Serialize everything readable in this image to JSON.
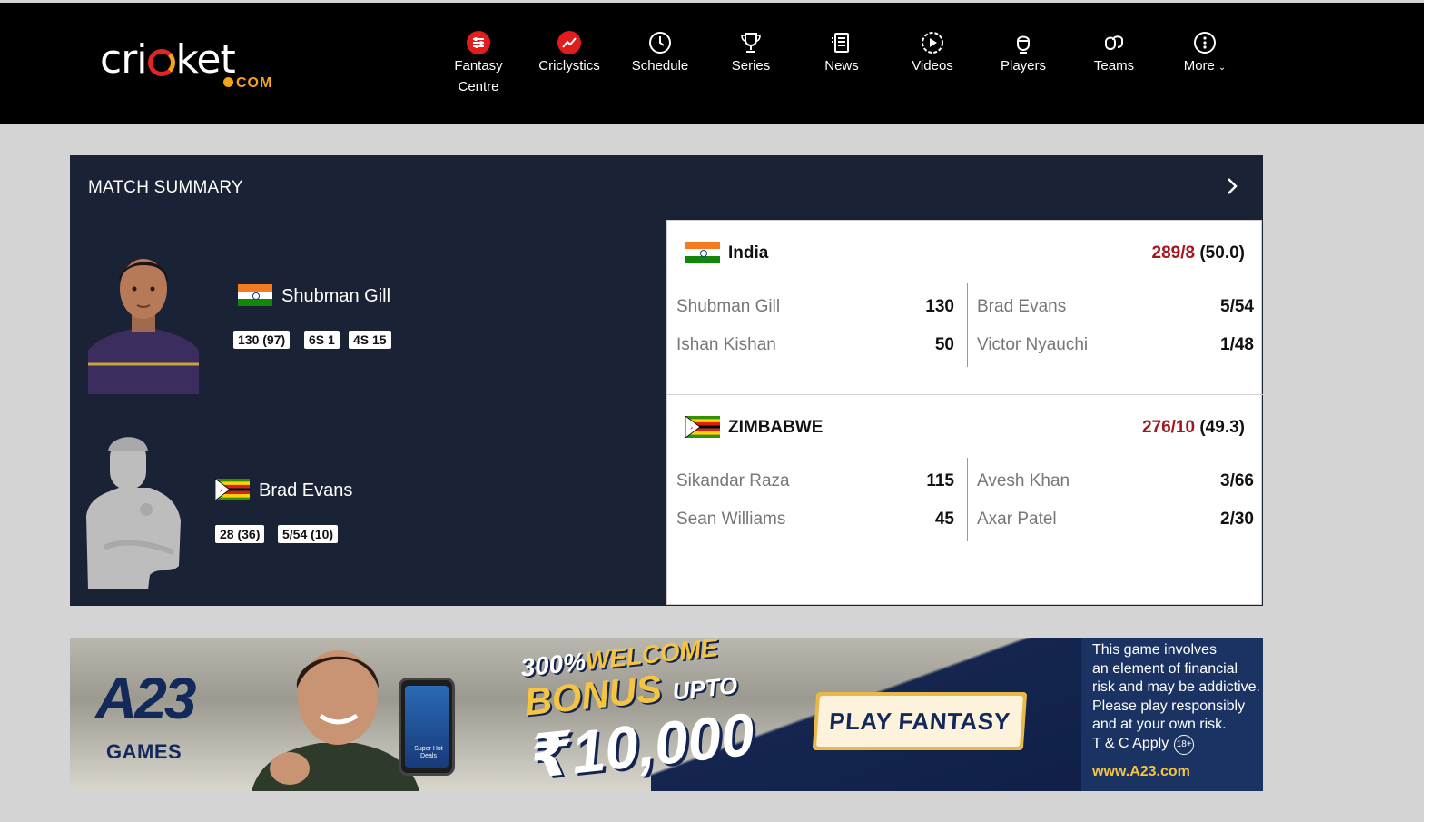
{
  "header": {
    "logo_word": "cricket",
    "logo_suffix": "COM",
    "nav": [
      {
        "label": "Fantasy",
        "label2": "Centre",
        "icon": "fantasy-centre-icon"
      },
      {
        "label": "Criclystics",
        "label2": "",
        "icon": "criclystics-icon"
      },
      {
        "label": "Schedule",
        "label2": "",
        "icon": "clock-icon"
      },
      {
        "label": "Series",
        "label2": "",
        "icon": "trophy-icon"
      },
      {
        "label": "News",
        "label2": "",
        "icon": "news-icon"
      },
      {
        "label": "Videos",
        "label2": "",
        "icon": "video-icon"
      },
      {
        "label": "Players",
        "label2": "",
        "icon": "player-icon"
      },
      {
        "label": "Teams",
        "label2": "",
        "icon": "teams-icon"
      },
      {
        "label": "More",
        "label2": "",
        "icon": "more-icon"
      }
    ]
  },
  "summary": {
    "title": "MATCH SUMMARY",
    "players": [
      {
        "name": "Shubman Gill",
        "country": "India",
        "stats": [
          "130 (97)",
          "6S 1",
          "4S 15"
        ]
      },
      {
        "name": "Brad Evans",
        "country": "Zimbabwe",
        "stats": [
          "28 (36)",
          "5/54 (10)"
        ]
      }
    ],
    "innings": [
      {
        "team": "India",
        "runs": "289/8",
        "overs": "(50.0)",
        "batters": [
          {
            "name": "Shubman Gill",
            "score": "130"
          },
          {
            "name": "Ishan Kishan",
            "score": "50"
          }
        ],
        "bowlers": [
          {
            "name": "Brad Evans",
            "figures": "5/54"
          },
          {
            "name": "Victor Nyauchi",
            "figures": "1/48"
          }
        ]
      },
      {
        "team": "ZIMBABWE",
        "runs": "276/10",
        "overs": "(49.3)",
        "batters": [
          {
            "name": "Sikandar Raza",
            "score": "115"
          },
          {
            "name": "Sean Williams",
            "score": "45"
          }
        ],
        "bowlers": [
          {
            "name": "Avesh Khan",
            "figures": "3/66"
          },
          {
            "name": "Axar Patel",
            "figures": "2/30"
          }
        ]
      }
    ]
  },
  "ad": {
    "brand": "A23",
    "brand_sub": "GAMES",
    "bonus_pct": "300%",
    "bonus_welcome": "WELCOME",
    "bonus_word": "BONUS",
    "bonus_upto": "UPTO",
    "bonus_amount": "₹10,000",
    "cta": "PLAY FANTASY",
    "phone_text": "Super Hot Deals",
    "disclaimer_lines": [
      "This game involves",
      "an element of financial",
      "risk and may be addictive.",
      "Please play responsibly",
      "and at your own risk."
    ],
    "tc": "T & C Apply",
    "age": "18+",
    "url": "www.A23.com"
  },
  "colors": {
    "header_bg": "#000000",
    "panel_bg": "#1a2236",
    "runs_red": "#a3171c",
    "page_bg": "#d4d4d4"
  }
}
